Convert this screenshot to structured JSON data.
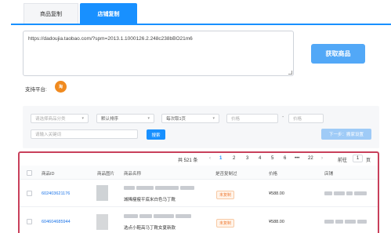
{
  "tabs": [
    {
      "label": "商品复制"
    },
    {
      "label": "店铺复制"
    }
  ],
  "url_input": {
    "value": "https://dadoujia.taobao.com/?spm=2013.1.1000126.2.248c238bBO21m6"
  },
  "fetch_button": {
    "label": "获取商品"
  },
  "platform": {
    "label": "支持平台:",
    "icon": "taobao-icon"
  },
  "filters": {
    "category_placeholder": "请选择商品分类",
    "sort_value": "默认排序",
    "per_page_value": "每次取1页",
    "price_min_placeholder": "价格",
    "price_max_placeholder": "价格",
    "dash": "-",
    "keyword_placeholder": "请输入关键词",
    "search_label": "搜索",
    "next_label": "下一步：搬家设置"
  },
  "pagination": {
    "total": "共 521 条",
    "prev": "‹",
    "pages": [
      "1",
      "2",
      "3",
      "4",
      "5",
      "6",
      "•••",
      "22"
    ],
    "next": "›",
    "goto_label": "前往",
    "goto_value": "1",
    "page_unit": "页"
  },
  "table": {
    "headers": [
      "商品ID",
      "商品图片",
      "商品名称",
      "是否复制过",
      "价格",
      "店铺"
    ],
    "rows": [
      {
        "id": "602403621176",
        "name": "城稀瘦瘦平底米白色马丁靴",
        "copied": "未复制",
        "price": "¥588.00"
      },
      {
        "id": "604604685944",
        "name": "选点小鞋高马丁靴女夏新款",
        "copied": "未复制",
        "price": "¥588.00"
      }
    ]
  },
  "colors": {
    "accent": "#1890ff",
    "highlight": "#c8405b",
    "badge": "#f07e3a"
  }
}
